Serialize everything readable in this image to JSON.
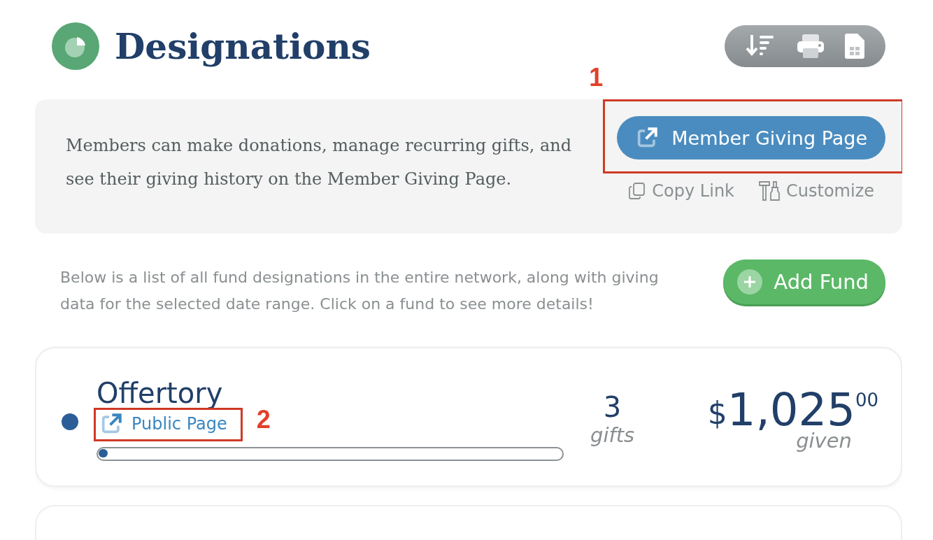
{
  "header": {
    "title": "Designations"
  },
  "giving_panel": {
    "text": "Members can make donations, manage recurring gifts, and see their giving history on the Member Giving Page.",
    "button": "Member Giving Page",
    "links": [
      "Copy Link",
      "Customize"
    ],
    "annotation": "1"
  },
  "intro": {
    "text": "Below is a list of all fund designations in the entire network, along with giving data for the selected date range. Click on a fund to see more details!",
    "button": "Add Fund"
  },
  "funds": [
    {
      "name": "Offertory",
      "color": "#2b5e97",
      "link": "Public Page",
      "annotation": "2",
      "level": 0.02,
      "gifts_count": "3",
      "gifts_label": "gifts",
      "currency": "$",
      "amount": "1,025",
      "cents": "00",
      "amount_label": "given"
    }
  ]
}
